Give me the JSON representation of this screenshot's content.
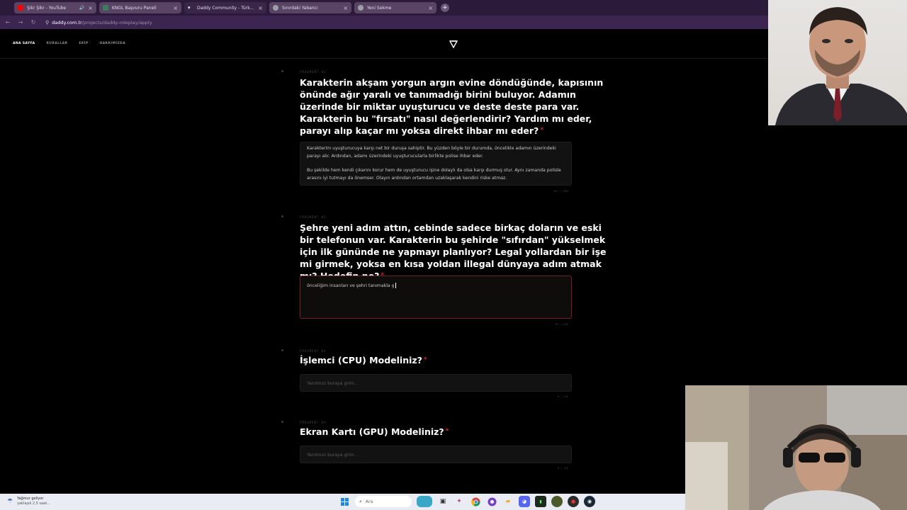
{
  "tabs": [
    {
      "title": "Şikr Şikr - YouTube",
      "icon": "youtube-icon",
      "color": "#ff0000",
      "audio": true
    },
    {
      "title": "KNGL Başvuru Paneli",
      "icon": "panel-icon",
      "color": "#3b7d5c"
    },
    {
      "title": "Daddy Community - Türkiye'nin",
      "icon": "daddy-icon",
      "color": "#ffffff",
      "active": true
    },
    {
      "title": "Sınırdaki Yabancı",
      "icon": "globe-icon",
      "color": "#9aa0a6"
    },
    {
      "title": "Yeni Sekme",
      "icon": "newtab-icon",
      "color": "#9aa0a6"
    }
  ],
  "address": {
    "host": "daddy.com.tr",
    "path": "/projects/daddy-roleplay/apply"
  },
  "nav": {
    "home": "ANA SAYFA",
    "rules": "KURALLAR",
    "team": "EKİP",
    "about": "HAKKIMIZDA"
  },
  "questions": [
    {
      "fragment": "FRAGMENT_02",
      "title": "Karakterin akşam yorgun argın evine döndüğünde, kapısının önünde ağır yaralı ve tanımadığı birini buluyor. Adamın üzerinde bir miktar uyuşturucu ve deste deste para var. Karakterin bu \"fırsatı\" nasıl değerlendirir? Yardım mı eder, parayı alıp kaçar mı yoksa direkt ihbar mı eder?",
      "answer_p1": "Karakterim uyuşturucuya karşı net bir duruşa sahiptir. Bu yüzden böyle bir durumda, öncelikle adamın üzerindeki parayı alır. Ardından, adamı üzerindeki uyuşturucularla birlikte polise ihbar eder.",
      "answer_p2": "Bu şekilde hem kendi çıkarını korur hem de uyuşturucu işine dolaylı da olsa karşı durmuş olur. Aynı zamanda polisle arasını iyi tutmayı da önemser. Olayın ardından ortamdan uzaklaşarak kendini riske atmaz.",
      "counter": "382 / 1000"
    },
    {
      "fragment": "FRAGMENT_03",
      "title": "Şehre yeni adım attın, cebinde sadece birkaç doların ve eski bir telefonun var. Karakterin bu şehirde \"sıfırdan\" yükselmek için ilk gününde ne yapmayı planlıyor? Legal yollardan bir işe mi girmek, yoksa en kısa yoldan illegal dünyaya adım atmak mı? Hedefin ne?",
      "answer": "önceliğim insanları ve şehri tanımakla g",
      "counter": "40 / 1000"
    },
    {
      "fragment": "FRAGMENT_04",
      "title": "İşlemci (CPU) Modeliniz?",
      "placeholder": "Yanıtınızı buraya girin...",
      "counter": "0 / 100"
    },
    {
      "fragment": "FRAGMENT_05",
      "title": "Ekran Kartı (GPU) Modeliniz?",
      "placeholder": "Yanıtınızı buraya girin...",
      "counter": "0 / 100"
    }
  ],
  "taskbar": {
    "weather_title": "Yağmur geliyor",
    "weather_sub": "yaklaşık 2,5 saat...",
    "search": "Ara"
  },
  "colors": {
    "accent": "#e0233b",
    "tabbar": "#2b1a3a",
    "addrbar": "#3c2651"
  }
}
